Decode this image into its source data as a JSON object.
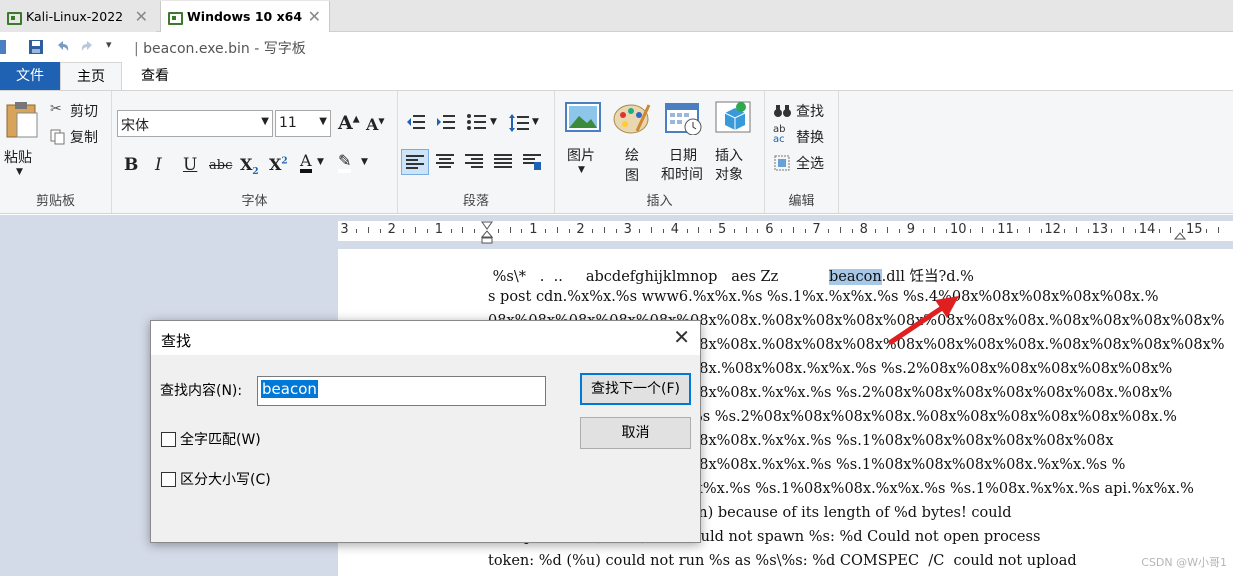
{
  "vm_tabs": [
    {
      "label": "Kali-Linux-2022"
    },
    {
      "label": "Windows 10 x64"
    }
  ],
  "window": {
    "title": "beacon.exe.bin - 写字板"
  },
  "ribbon_tabs": {
    "file": "文件",
    "home": "主页",
    "view": "查看"
  },
  "clipboard": {
    "paste": "粘贴",
    "cut": "剪切",
    "copy": "复制",
    "caption": "剪贴板"
  },
  "font": {
    "family": "宋体",
    "size": "11",
    "caption": "字体"
  },
  "paragraph": {
    "caption": "段落"
  },
  "insert": {
    "picture": "图片",
    "paint": "绘\n图",
    "datetime_1": "日期",
    "datetime_2": "和时间",
    "object_1": "插入",
    "object_2": "对象",
    "caption": "插入"
  },
  "editing": {
    "find": "查找",
    "replace": "替换",
    "select_all": "全选",
    "caption": "编辑"
  },
  "ruler": {
    "numbers": [
      "3",
      "2",
      "1",
      "1",
      "2",
      "3",
      "4",
      "5",
      "6",
      "7",
      "8",
      "9",
      "10",
      "11",
      "12",
      "13",
      "14",
      "15"
    ]
  },
  "document_lines": [
    {
      "pre": " %s\\*   .  ..     abcdefghijklmnop   aes Zz           ",
      "hl": "beacon",
      "post": ".dll 饪当?d.%"
    },
    {
      "pre": "s post cdn.%x%x.%s www6.%x%x.%s %s.1%x.%x%x.%s %s.4%08x%08x%08x%08x%08x.%",
      "hl": "",
      "post": ""
    },
    {
      "pre": "08x%08x%08x%08x%08x%08x%08x.%08x%08x%08x%08x%08x%08x%08x.%08x%08x%08x%08x%",
      "hl": "",
      "post": ""
    },
    {
      "pre": "08x%08x%08x%08x%08x%08x%08x.%08x%08x%08x%08x%08x%08x%08x.%08x%08x%08x%08x%",
      "hl": "",
      "post": ""
    },
    {
      "pre": "08x%08x%08x%08x%08x%08x.%08x%08x.%x%x.%s %s.2%08x%08x%08x%08x%08x%08x%",
      "hl": "",
      "post": ""
    },
    {
      "pre": "08x%08x%08x%08x%08x%08x%08x.%x%x.%s %s.2%08x%08x%08x%08x%08x%08x.%08x%",
      "hl": "",
      "post": ""
    },
    {
      "pre": "08x%08x%08x%08x.%x%x.%s %s.2%08x%08x%08x%08x.%08x%08x%08x%08x%08x%08x.%",
      "hl": "",
      "post": ""
    },
    {
      "pre": "08x%08x%08x%08x%08x%08x%08x.%x%x.%s %s.1%08x%08x%08x%08x%08x%08x",
      "hl": "",
      "post": ""
    },
    {
      "pre": "08x%08x%08x%08x%08x%08x%08x.%x%x.%s %s.1%08x%08x%08x%08x.%x%x.%s %",
      "hl": "",
      "post": ""
    },
    {
      "pre": "08x%08x%08x%08x%08x.%x%x.%s %s.1%08x%08x.%x%x.%s %s.1%08x.%x%x.%s api.%x%x.%",
      "hl": "",
      "post": ""
    },
    {
      "pre": "could not spawn %s (w/ token) because of its length of %d bytes! could",
      "hl": "",
      "post": ""
    },
    {
      "pre": "not spawn %s (token): %d could not spawn %s: %d Could not open process",
      "hl": "",
      "post": ""
    },
    {
      "pre": "token: %d (%u) could not run %s as %s\\%s: %d COMSPEC  /C  could not upload",
      "hl": "",
      "post": ""
    }
  ],
  "find_dialog": {
    "title": "查找",
    "find_label": "查找内容(N):",
    "find_value": "beacon",
    "find_next": "查找下一个(F)",
    "cancel": "取消",
    "whole_word": "全字匹配(W)",
    "match_case": "区分大小写(C)"
  },
  "watermark": "CSDN @W小哥1",
  "colors": {
    "accent": "#1f62b3",
    "selection": "#0078d7",
    "arrow": "#e02020"
  }
}
